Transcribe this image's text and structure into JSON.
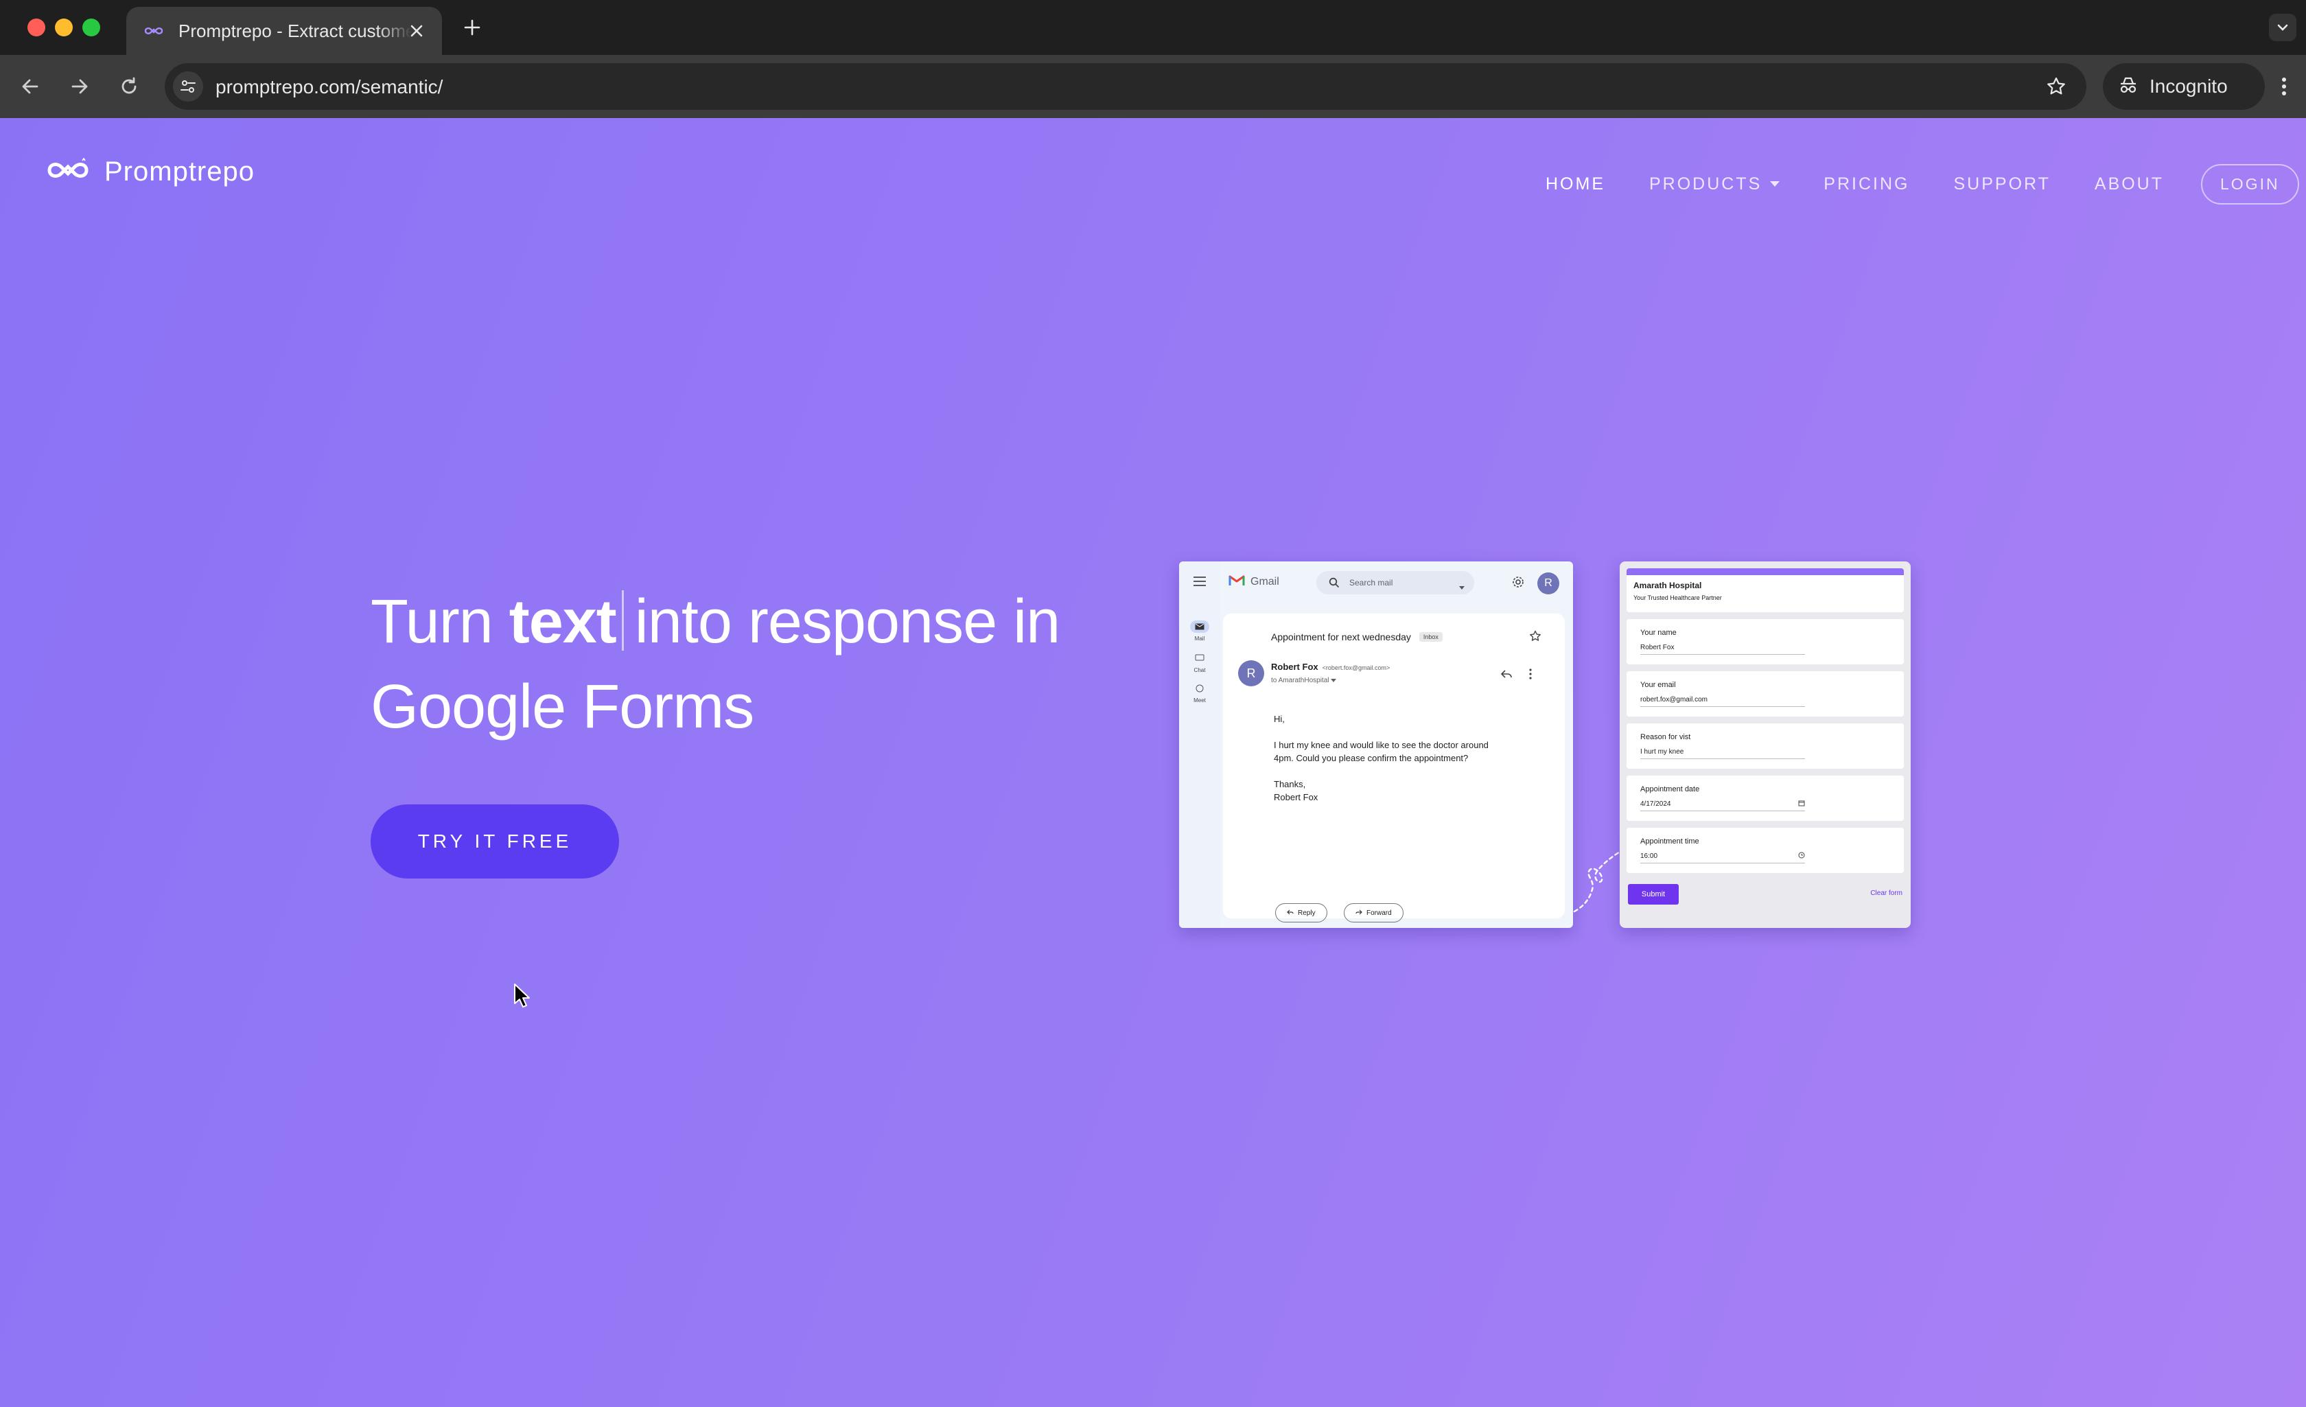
{
  "browser": {
    "tab_title": "Promptrepo - Extract customer data",
    "url": "promptrepo.com/semantic/",
    "profile_label": "Incognito"
  },
  "site": {
    "brand": "Promptrepo",
    "nav": {
      "home": "HOME",
      "products": "PRODUCTS",
      "pricing": "PRICING",
      "support": "SUPPORT",
      "about": "ABOUT",
      "login": "LOGIN"
    },
    "hero": {
      "part1": "Turn ",
      "bold": "text",
      "part2": "into response in",
      "line2": "Google Forms",
      "cta": "TRY IT FREE"
    }
  },
  "gmail": {
    "logo": "Gmail",
    "search_placeholder": "Search mail",
    "avatar": "R",
    "rail": {
      "mail": "Mail",
      "chat": "Chat",
      "meet": "Meet"
    },
    "subject": "Appointment for next wednesday",
    "badge": "Inbox",
    "sender_initial": "R",
    "sender": "Robert Fox",
    "sender_email": "<robert.fox@gmail.com>",
    "to": "to AmarathHospital",
    "body_greeting": "Hi,",
    "body_main": "I hurt my knee and would like to see the doctor around 4pm. Could you please confirm the appointment?",
    "body_thanks": "Thanks,",
    "body_name": "Robert Fox",
    "reply": "Reply",
    "forward": "Forward"
  },
  "form": {
    "title": "Amarath Hospital",
    "subtitle": "Your Trusted Healthcare Partner",
    "fields": [
      {
        "label": "Your name",
        "value": "Robert Fox"
      },
      {
        "label": "Your email",
        "value": "robert.fox@gmail.com"
      },
      {
        "label": "Reason for vist",
        "value": "I hurt my knee"
      },
      {
        "label": "Appointment date",
        "value": "4/17/2024"
      },
      {
        "label": "Appointment time",
        "value": "16:00"
      }
    ],
    "submit": "Submit",
    "clear": "Clear form"
  },
  "colors": {
    "page_gradient_start": "#8b72f5",
    "page_gradient_end": "#ab80f5",
    "cta": "#5b3cf0",
    "form_accent": "#6f35ee"
  }
}
